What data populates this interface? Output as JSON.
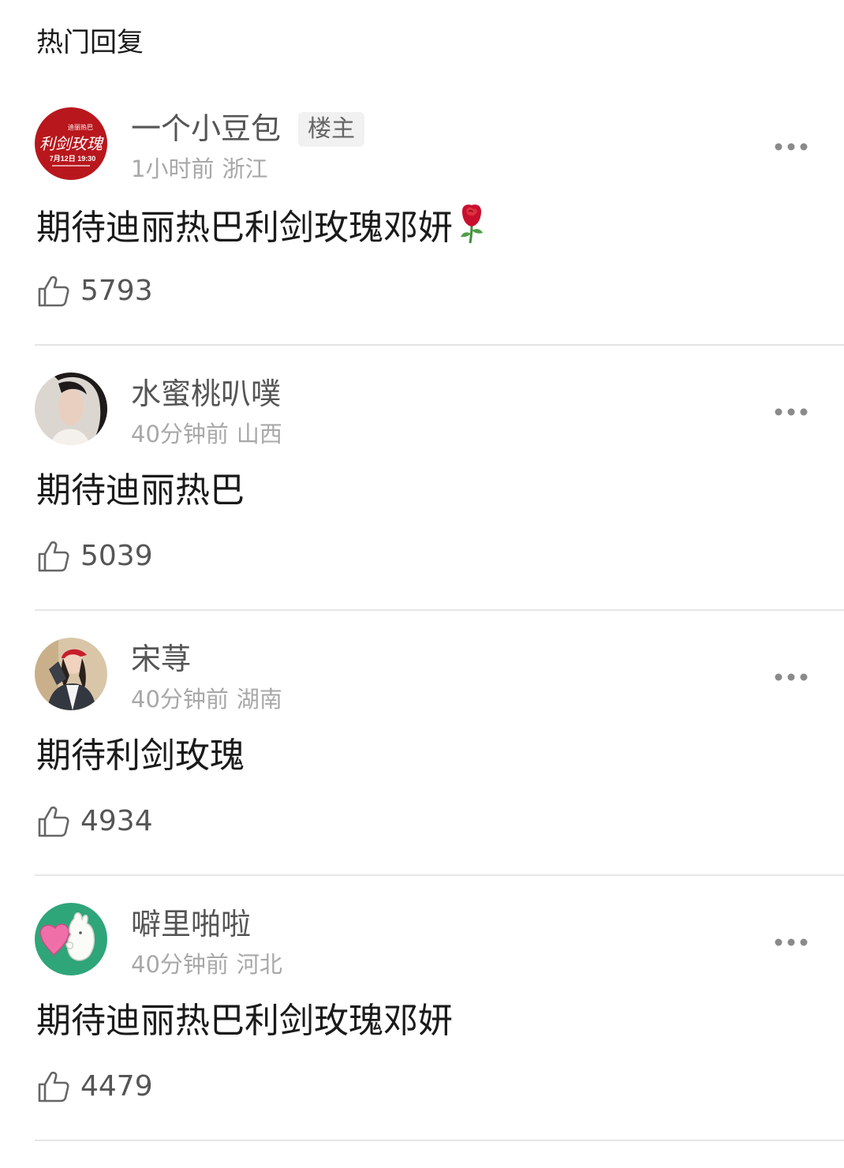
{
  "section_title": "热门回复",
  "comments": [
    {
      "username": "一个小豆包",
      "badge": "楼主",
      "time": "1小时前",
      "location": "浙江",
      "content": "期待迪丽热巴利剑玫瑰邓妍",
      "emoji": "rose-emoji",
      "likes": "5793",
      "avatar_text": {
        "top": "迪丽热巴",
        "title": "利剑玫瑰",
        "date": "7月12日 19:30"
      }
    },
    {
      "username": "水蜜桃叭噗",
      "time": "40分钟前",
      "location": "山西",
      "content": "期待迪丽热巴",
      "likes": "5039"
    },
    {
      "username": "宋荨",
      "time": "40分钟前",
      "location": "湖南",
      "content": "期待利剑玫瑰",
      "likes": "4934"
    },
    {
      "username": "噼里啪啦",
      "time": "40分钟前",
      "location": "河北",
      "content": "期待迪丽热巴利剑玫瑰邓妍",
      "likes": "4479"
    }
  ],
  "icons": {
    "like": "thumbs-up-icon",
    "more": "more-dots-icon"
  },
  "colors": {
    "avatar1_bg": "#b8171d",
    "avatar4_bg": "#2fa57a",
    "divider": "#e6e6e6",
    "meta_text": "#a8a8a8"
  }
}
